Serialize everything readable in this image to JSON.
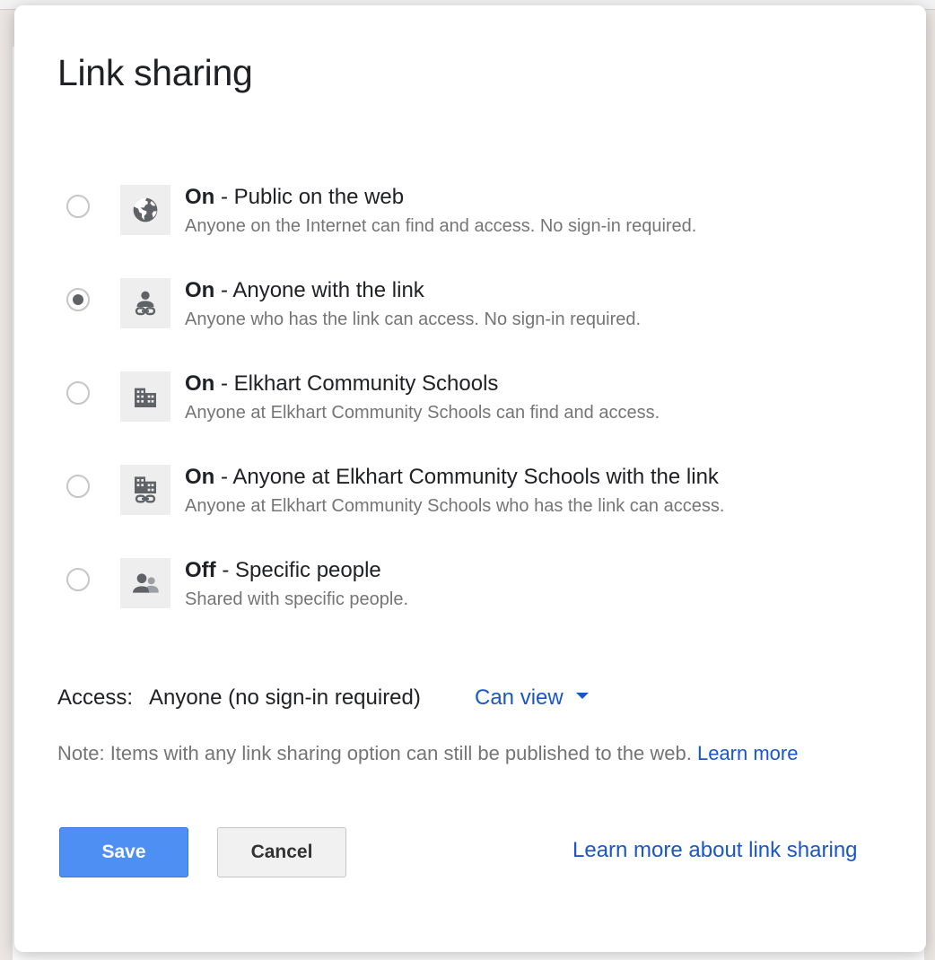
{
  "dialog": {
    "title": "Link sharing"
  },
  "options": [
    {
      "state": "On",
      "title": " - Public on the web",
      "description": "Anyone on the Internet can find and access. No sign-in required.",
      "icon": "globe-icon",
      "selected": false
    },
    {
      "state": "On",
      "title": " - Anyone with the link",
      "description": "Anyone who has the link can access. No sign-in required.",
      "icon": "person-link-icon",
      "selected": true
    },
    {
      "state": "On",
      "title": " - Elkhart Community Schools",
      "description": "Anyone at Elkhart Community Schools can find and access.",
      "icon": "building-icon",
      "selected": false
    },
    {
      "state": "On",
      "title": " - Anyone at Elkhart Community Schools with the link",
      "description": "Anyone at Elkhart Community Schools who has the link can access.",
      "icon": "building-link-icon",
      "selected": false
    },
    {
      "state": "Off",
      "title": " - Specific people",
      "description": "Shared with specific people.",
      "icon": "people-icon",
      "selected": false
    }
  ],
  "access": {
    "label": "Access:",
    "value": "Anyone (no sign-in required)",
    "permission": "Can view"
  },
  "note": {
    "text": "Note: Items with any link sharing option can still be published to the web.",
    "link": "Learn more"
  },
  "buttons": {
    "save": "Save",
    "cancel": "Cancel"
  },
  "footer": {
    "learn_more": "Learn more about link sharing"
  },
  "colors": {
    "primary": "#4d8ff2",
    "link": "#1a56c9",
    "secondary_text": "#757575"
  }
}
